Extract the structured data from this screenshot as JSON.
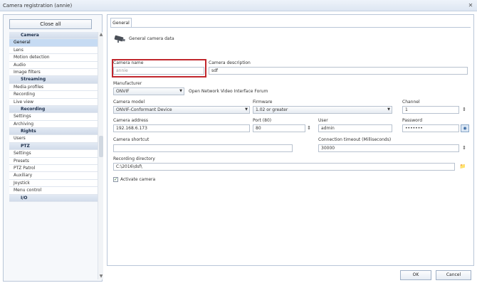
{
  "window": {
    "title": "Camera registration (annie)",
    "close_glyph": "✕"
  },
  "sidebar": {
    "close_all": "Close all",
    "items": [
      {
        "label": "Camera",
        "kind": "header"
      },
      {
        "label": "General",
        "kind": "selected"
      },
      {
        "label": "Lens",
        "kind": "item"
      },
      {
        "label": "Motion detection",
        "kind": "item"
      },
      {
        "label": "Audio",
        "kind": "item"
      },
      {
        "label": "Image filters",
        "kind": "item"
      },
      {
        "label": "Streaming",
        "kind": "header"
      },
      {
        "label": "Media profiles",
        "kind": "item"
      },
      {
        "label": "Recording",
        "kind": "item"
      },
      {
        "label": "Live view",
        "kind": "item"
      },
      {
        "label": "Recording",
        "kind": "header"
      },
      {
        "label": "Settings",
        "kind": "item"
      },
      {
        "label": "Archiving",
        "kind": "item"
      },
      {
        "label": "Rights",
        "kind": "header"
      },
      {
        "label": "Users",
        "kind": "item"
      },
      {
        "label": "PTZ",
        "kind": "header"
      },
      {
        "label": "Settings",
        "kind": "item"
      },
      {
        "label": "Presets",
        "kind": "item"
      },
      {
        "label": "PTZ Patrol",
        "kind": "item"
      },
      {
        "label": "Auxiliary",
        "kind": "item"
      },
      {
        "label": "Joystick",
        "kind": "item"
      },
      {
        "label": "Menu control",
        "kind": "item"
      },
      {
        "label": "I/O",
        "kind": "header"
      }
    ]
  },
  "tab": {
    "label": "General"
  },
  "section": {
    "title": "General camera data",
    "icon": "camera-icon"
  },
  "form": {
    "camera_name_label": "Camera name",
    "camera_name_value": "annie",
    "camera_description_label": "Camera description",
    "camera_description_value": "sdf",
    "manufacturer_label": "Manufacturer",
    "manufacturer_value": "ONVIF",
    "manufacturer_desc": "Open Network Video Interface Forum",
    "camera_model_label": "Camera model",
    "camera_model_value": "ONVIF-Conformant Device",
    "firmware_label": "Firmware",
    "firmware_value": "1.02 or greater",
    "channel_label": "Channel",
    "channel_value": "1",
    "camera_address_label": "Camera address",
    "camera_address_value": "192.168.6.173",
    "port_label": "Port (80)",
    "port_value": "80",
    "user_label": "User",
    "user_value": "admin",
    "password_label": "Password",
    "password_value": "•••••••",
    "shortcut_label": "Camera shortcut",
    "shortcut_value": "",
    "timeout_label": "Connection timeout (Milliseconds)",
    "timeout_value": "30000",
    "recording_dir_label": "Recording directory",
    "recording_dir_value": "C:\\2016\\dsf\\",
    "activate_label": "Activate camera",
    "activate_checked": "✓"
  },
  "footer": {
    "ok": "OK",
    "cancel": "Cancel"
  },
  "colors": {
    "highlight": "#c1272d",
    "selected": "#c6dbf3",
    "header": "#d2dcea"
  }
}
